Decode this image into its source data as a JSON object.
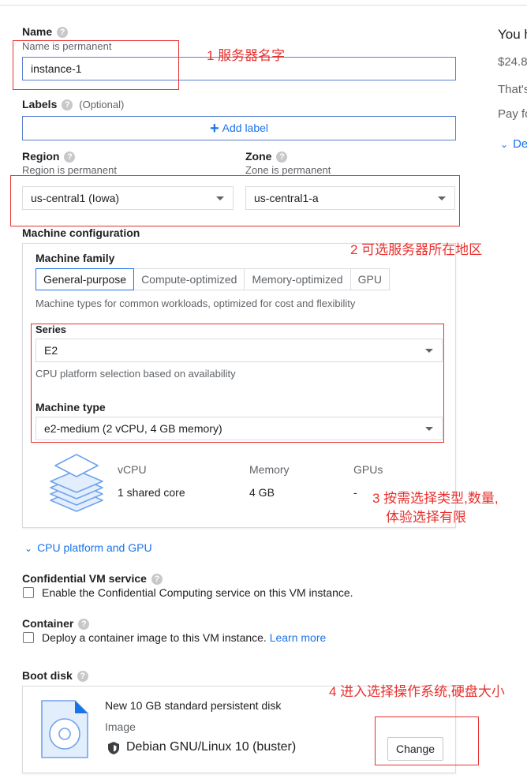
{
  "name_section": {
    "label": "Name",
    "subtitle": "Name is permanent",
    "value": "instance-1"
  },
  "labels_section": {
    "label": "Labels",
    "optional": "(Optional)",
    "add_label": "Add label"
  },
  "region": {
    "label": "Region",
    "subtitle": "Region is permanent",
    "value": "us-central1 (Iowa)"
  },
  "zone": {
    "label": "Zone",
    "subtitle": "Zone is permanent",
    "value": "us-central1-a"
  },
  "machine_config": {
    "title": "Machine configuration",
    "family_label": "Machine family",
    "tabs": [
      "General-purpose",
      "Compute-optimized",
      "Memory-optimized",
      "GPU"
    ],
    "family_desc": "Machine types for common workloads, optimized for cost and flexibility",
    "series_label": "Series",
    "series_value": "E2",
    "series_desc": "CPU platform selection based on availability",
    "type_label": "Machine type",
    "type_value": "e2-medium (2 vCPU, 4 GB memory)",
    "specs": {
      "vcpu_header": "vCPU",
      "vcpu_value": "1 shared core",
      "memory_header": "Memory",
      "memory_value": "4 GB",
      "gpus_header": "GPUs",
      "gpus_value": "-"
    }
  },
  "cpu_platform_link": "CPU platform and GPU",
  "confidential": {
    "label": "Confidential VM service",
    "checkbox_text": "Enable the Confidential Computing service on this VM instance."
  },
  "container": {
    "label": "Container",
    "checkbox_text": "Deploy a container image to this VM instance.",
    "learn_more": "Learn more"
  },
  "boot_disk": {
    "label": "Boot disk",
    "disk_title": "New 10 GB standard persistent disk",
    "image_label": "Image",
    "image_value": "Debian GNU/Linux 10 (buster)",
    "change_button": "Change"
  },
  "side_panel": {
    "line1": "You h",
    "line2": "$24.8",
    "line3": "That's",
    "line4": "Pay fo",
    "line5": "De"
  },
  "annotations": {
    "a1": "1 服务器名字",
    "a2": "2 可选服务器所在地区",
    "a3_line1": "3 按需选择类型,数量,",
    "a3_line2": "体验选择有限",
    "a4": "4 进入选择操作系统,硬盘大小"
  },
  "colors": {
    "accent": "#1a73e8",
    "annotation_red": "#e8302e"
  }
}
